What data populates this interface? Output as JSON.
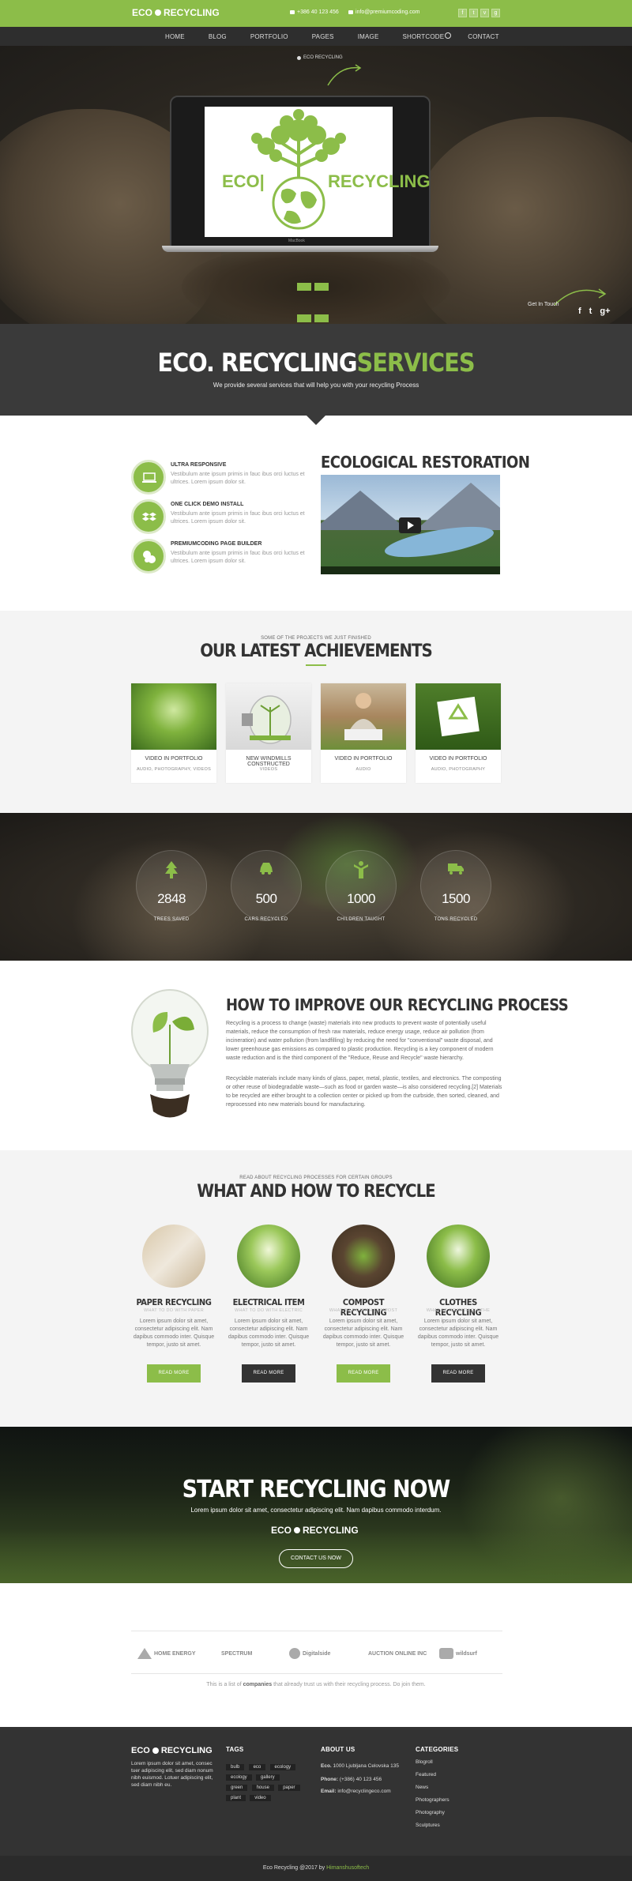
{
  "topbar": {
    "logo_left": "ECO",
    "logo_right": "RECYCLING",
    "phone": "+386 40 123 456",
    "email": "info@premiumcoding.com",
    "social": [
      "f",
      "t",
      "v",
      "g"
    ]
  },
  "nav": {
    "items": [
      "HOME",
      "BLOG",
      "PORTFOLIO",
      "PAGES",
      "IMAGE",
      "SHORTCODE",
      "CONTACT"
    ]
  },
  "hero": {
    "small_logo": "ECO RECYCLING",
    "laptop_left_word": "ECO|",
    "laptop_right_word": "RECYCLING",
    "laptop_brand": "MacBook",
    "get_in_touch": "Get In Touch",
    "social": [
      "f",
      "t",
      "g+"
    ]
  },
  "services": {
    "title_white": "ECO. RECYCLING",
    "title_green": "SERVICES",
    "subtitle": "We provide several services that will help you with your recycling Process"
  },
  "features": [
    {
      "title": "ULTRA RESPONSIVE",
      "desc": "Vestibulum ante ipsum primis in fauc ibus orci luctus et ultrices. Lorem ipsum dolor sit.",
      "icon": "laptop-icon"
    },
    {
      "title": "ONE CLICK DEMO INSTALL",
      "desc": "Vestibulum ante ipsum primis in fauc ibus orci luctus et ultrices. Lorem ipsum dolor sit.",
      "icon": "dropbox-icon"
    },
    {
      "title": "PREMIUMCODING PAGE BUILDER",
      "desc": "Vestibulum ante ipsum primis in fauc ibus orci luctus et ultrices. Lorem ipsum dolor sit.",
      "icon": "puzzle-icon"
    }
  ],
  "eco_restoration": {
    "title": "ECOLOGICAL RESTORATION"
  },
  "achievements": {
    "kicker": "SOME OF THE PROJECTS WE JUST FINISHED",
    "title_left": "OUR LATEST ",
    "title_right": "ACHIEVEMENTS",
    "cards": [
      {
        "title": "VIDEO IN PORTFOLIO",
        "sub": "AUDIO, PHOTOGRAPHY, VIDEOS"
      },
      {
        "title": "NEW WINDMILLS CONSTRUCTED",
        "sub": "VIDEOS"
      },
      {
        "title": "VIDEO IN PORTFOLIO",
        "sub": "AUDIO"
      },
      {
        "title": "VIDEO IN PORTFOLIO",
        "sub": "AUDIO, PHOTOGRAPHY"
      }
    ]
  },
  "stats": [
    {
      "value": "2848",
      "label": "TREES SAVED",
      "icon": "tree-icon"
    },
    {
      "value": "500",
      "label": "CARS RECYCLED",
      "icon": "car-icon"
    },
    {
      "value": "1000",
      "label": "CHILDREN TAUGHT",
      "icon": "child-icon"
    },
    {
      "value": "1500",
      "label": "TONS RECYCLED",
      "icon": "truck-icon"
    }
  ],
  "improve": {
    "title": "HOW TO IMPROVE OUR RECYCLING PROCESS",
    "p1": "Recycling is a process to change (waste) materials into new products to prevent waste of potentially useful materials, reduce the consumption of fresh raw materials, reduce energy usage, reduce air pollution (from incineration) and water pollution (from landfilling) by reducing the need for \"conventional\" waste disposal, and lower greenhouse gas emissions as compared to plastic production. Recycling is a key component of modern waste reduction and is the third component of the \"Reduce, Reuse and Recycle\" waste hierarchy.",
    "p2": "Recyclable materials include many kinds of glass, paper, metal, plastic, textiles, and electronics. The composting or other reuse of biodegradable waste—such as food or garden waste—is also considered recycling.[2] Materials to be recycled are either brought to a collection center or picked up from the curbside, then sorted, cleaned, and reprocessed into new materials bound for manufacturing."
  },
  "whathow": {
    "kicker": "READ ABOUT RECYCLING PROCESSES FOR CERTAIN GROUPS",
    "title": "WHAT AND HOW TO RECYCLE",
    "items": [
      {
        "title": "PAPER RECYCLING",
        "sub": "WHAT TO DO WITH PAPER",
        "desc": "Lorem ipsum dolor sit amet, consectetur adipiscing elit. Nam dapibus commodo inter. Quisque tempor, justo sit amet.",
        "btn": "READ MORE",
        "btn_color": "#8cbd49"
      },
      {
        "title": "ELECTRICAL ITEM",
        "sub": "WHAT TO DO WITH ELECTRIC",
        "desc": "Lorem ipsum dolor sit amet, consectetur adipiscing elit. Nam dapibus commodo inter. Quisque tempor, justo sit amet.",
        "btn": "READ MORE",
        "btn_color": "#333333"
      },
      {
        "title": "COMPOST RECYCLING",
        "sub": "WHAT TO DO WITH COMPOST",
        "desc": "Lorem ipsum dolor sit amet, consectetur adipiscing elit. Nam dapibus commodo inter. Quisque tempor, justo sit amet.",
        "btn": "READ MORE",
        "btn_color": "#8cbd49"
      },
      {
        "title": "CLOTHES RECYCLING",
        "sub": "WHAT TO DO WITH CLOTHE",
        "desc": "Lorem ipsum dolor sit amet, consectetur adipiscing elit. Nam dapibus commodo inter. Quisque tempor, justo sit amet.",
        "btn": "READ MORE",
        "btn_color": "#333333"
      }
    ]
  },
  "cta": {
    "title": "START RECYCLING NOW",
    "sub": "Lorem ipsum dolor sit amet, consectetur adipiscing elit. Nam dapibus commodo interdum.",
    "logo_left": "ECO",
    "logo_right": "RECYCLING",
    "button": "CONTACT US NOW"
  },
  "partners": {
    "names": [
      "HOME ENERGY",
      "SPECTRUM",
      "Digitalside",
      "AUCTION ONLINE INC",
      "wildsurf"
    ],
    "note_pre": "This is a list of ",
    "note_bold": "companies",
    "note_post": " that already trust us with their recycling process. Do join them."
  },
  "footer": {
    "logo_left": "ECO",
    "logo_right": "RECYCLING",
    "about_text": "Lorem ipsum dolor sit amet, consec tuer adipiscing elit, sed diam nonum nibh euismod. Lotuer adipiscing elit, sed diam nibh eu.",
    "tags_head": "TAGS",
    "tags": [
      "bulb",
      "eco",
      "ecology",
      "ecology",
      "gallery",
      "green",
      "house",
      "paper",
      "plant",
      "video"
    ],
    "about_head": "ABOUT US",
    "eco_line_label": "Eco.",
    "eco_line": " 1000 Ljubljana Celovska 135",
    "phone_label": "Phone:",
    "phone": " (+386) 40 123 456",
    "email_label": "Email:",
    "email": " info@recyclingeco.com",
    "cats_head": "CATEGORIES",
    "categories": [
      "Blogroll",
      "Featured",
      "News",
      "Photographers",
      "Photography",
      "Sculptures"
    ],
    "copyright_pre": "Eco Recycling @2017 by ",
    "copyright_author": "Himanshusoftech"
  },
  "colors": {
    "accent": "#8cbd49",
    "dark": "#333333",
    "nav": "#2e2e2e"
  }
}
